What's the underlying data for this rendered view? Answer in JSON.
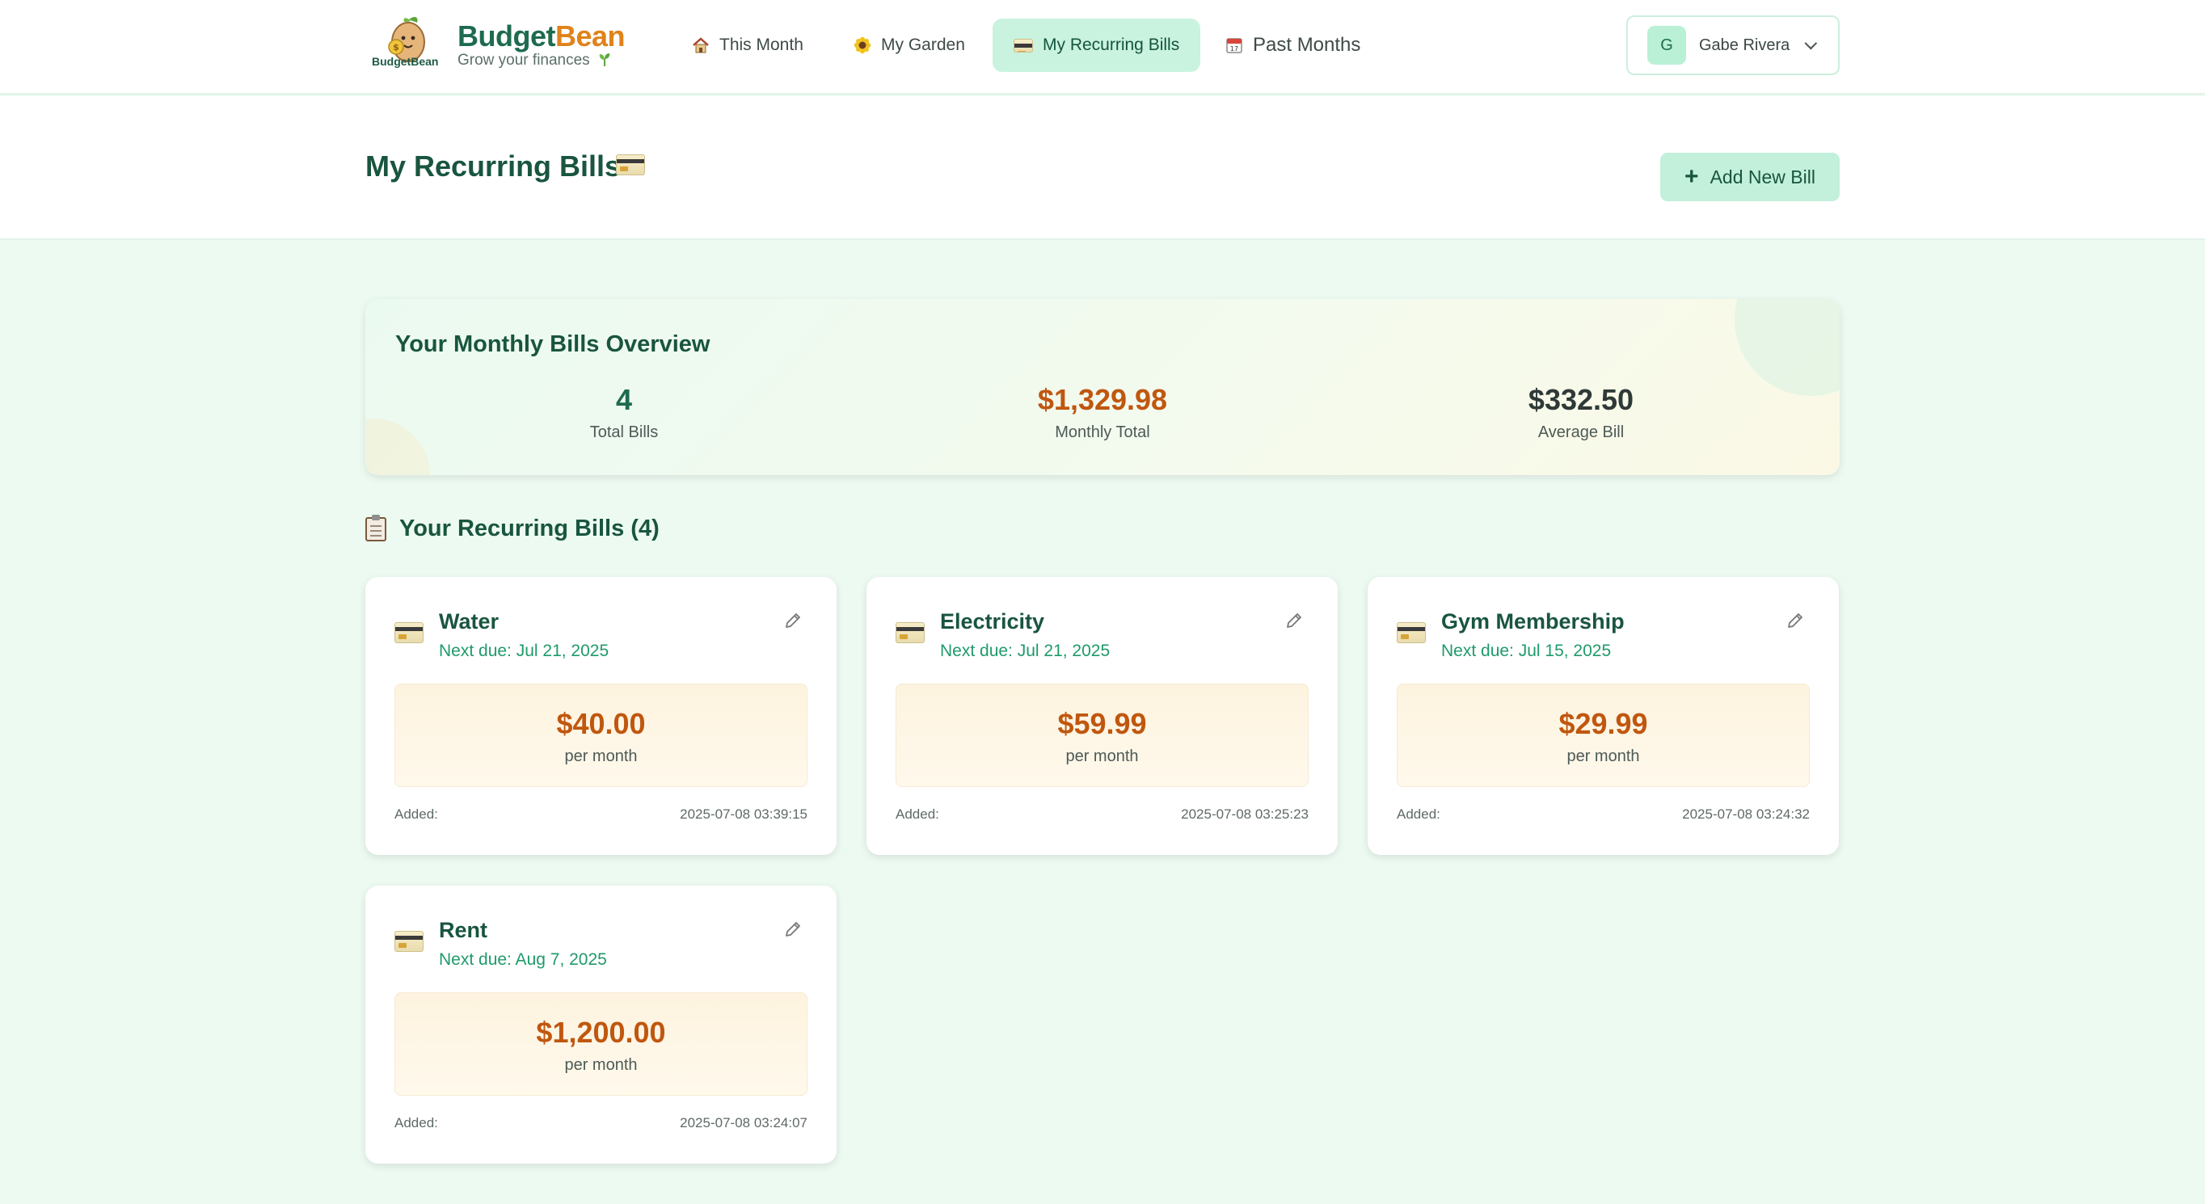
{
  "brand": {
    "name_part1": "Budget",
    "name_part2": "Bean",
    "tagline": "Grow your finances",
    "logo_caption": "BudgetBean"
  },
  "nav": {
    "items": [
      {
        "label": "This Month",
        "icon": "house-icon"
      },
      {
        "label": "My Garden",
        "icon": "sunflower-icon"
      },
      {
        "label": "My Recurring Bills",
        "icon": "credit-card-icon",
        "active": true
      },
      {
        "label": "Past Months",
        "icon": "calendar-icon"
      }
    ]
  },
  "user": {
    "initial": "G",
    "name": "Gabe Rivera"
  },
  "page": {
    "title": "My Recurring Bills",
    "add_button": "Add New Bill"
  },
  "overview": {
    "title": "Your Monthly Bills Overview",
    "stats": [
      {
        "value": "4",
        "label": "Total Bills",
        "color": "#1e6b4f"
      },
      {
        "value": "$1,329.98",
        "label": "Monthly Total",
        "color": "#c0570f"
      },
      {
        "value": "$332.50",
        "label": "Average Bill",
        "color": "#2f3a37"
      }
    ]
  },
  "bills_section": {
    "title": "Your Recurring Bills (4)"
  },
  "bills": [
    {
      "name": "Water",
      "due": "Next due: Jul 21, 2025",
      "amount": "$40.00",
      "per": "per month",
      "added_label": "Added:",
      "added": "2025-07-08 03:39:15"
    },
    {
      "name": "Electricity",
      "due": "Next due: Jul 21, 2025",
      "amount": "$59.99",
      "per": "per month",
      "added_label": "Added:",
      "added": "2025-07-08 03:25:23"
    },
    {
      "name": "Gym Membership",
      "due": "Next due: Jul 15, 2025",
      "amount": "$29.99",
      "per": "per month",
      "added_label": "Added:",
      "added": "2025-07-08 03:24:32"
    },
    {
      "name": "Rent",
      "due": "Next due: Aug 7, 2025",
      "amount": "$1,200.00",
      "per": "per month",
      "added_label": "Added:",
      "added": "2025-07-08 03:24:07"
    }
  ],
  "colors": {
    "brand_green": "#1e6b4f",
    "brand_orange": "#e0821a",
    "amount_orange": "#c0570f",
    "active_nav_bg": "#c9f3df",
    "page_bg": "#ecfaf1"
  }
}
